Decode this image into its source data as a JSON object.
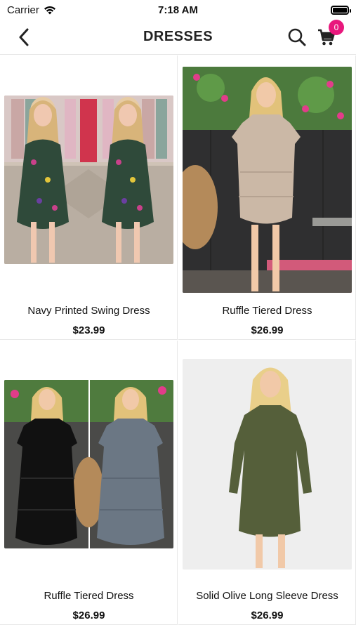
{
  "status_bar": {
    "carrier": "Carrier",
    "time": "7:18 AM"
  },
  "nav": {
    "title": "DRESSES",
    "cart_count": "0"
  },
  "products": [
    {
      "name": "Navy Printed Swing Dress",
      "price": "$23.99"
    },
    {
      "name": "Ruffle Tiered Dress",
      "price": "$26.99"
    },
    {
      "name": "Ruffle Tiered Dress",
      "price": "$26.99"
    },
    {
      "name": "Solid Olive Long Sleeve Dress",
      "price": "$26.99"
    }
  ],
  "colors": {
    "badge": "#e8187d",
    "divider": "#e8e8e8"
  }
}
